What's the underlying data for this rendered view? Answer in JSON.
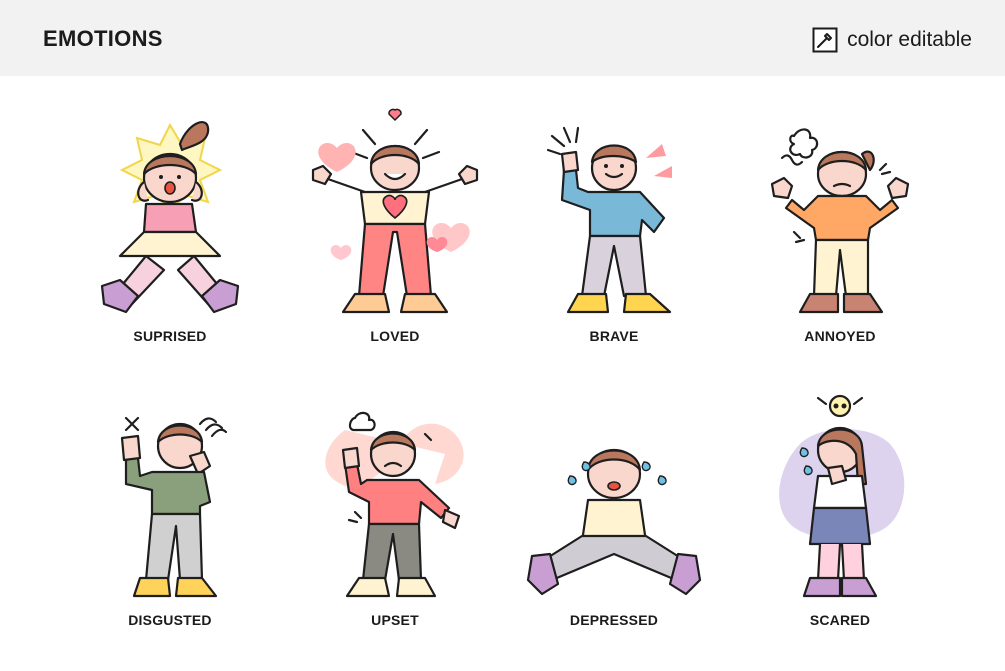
{
  "header": {
    "title": "EMOTIONS",
    "badge_label": "color editable",
    "badge_icon": "eyedropper-icon"
  },
  "emotions": [
    {
      "label": "SUPRISED"
    },
    {
      "label": "LOVED"
    },
    {
      "label": "BRAVE"
    },
    {
      "label": "ANNOYED"
    },
    {
      "label": "DISGUSTED"
    },
    {
      "label": "UPSET"
    },
    {
      "label": "DEPRESSED"
    },
    {
      "label": "SCARED"
    }
  ]
}
